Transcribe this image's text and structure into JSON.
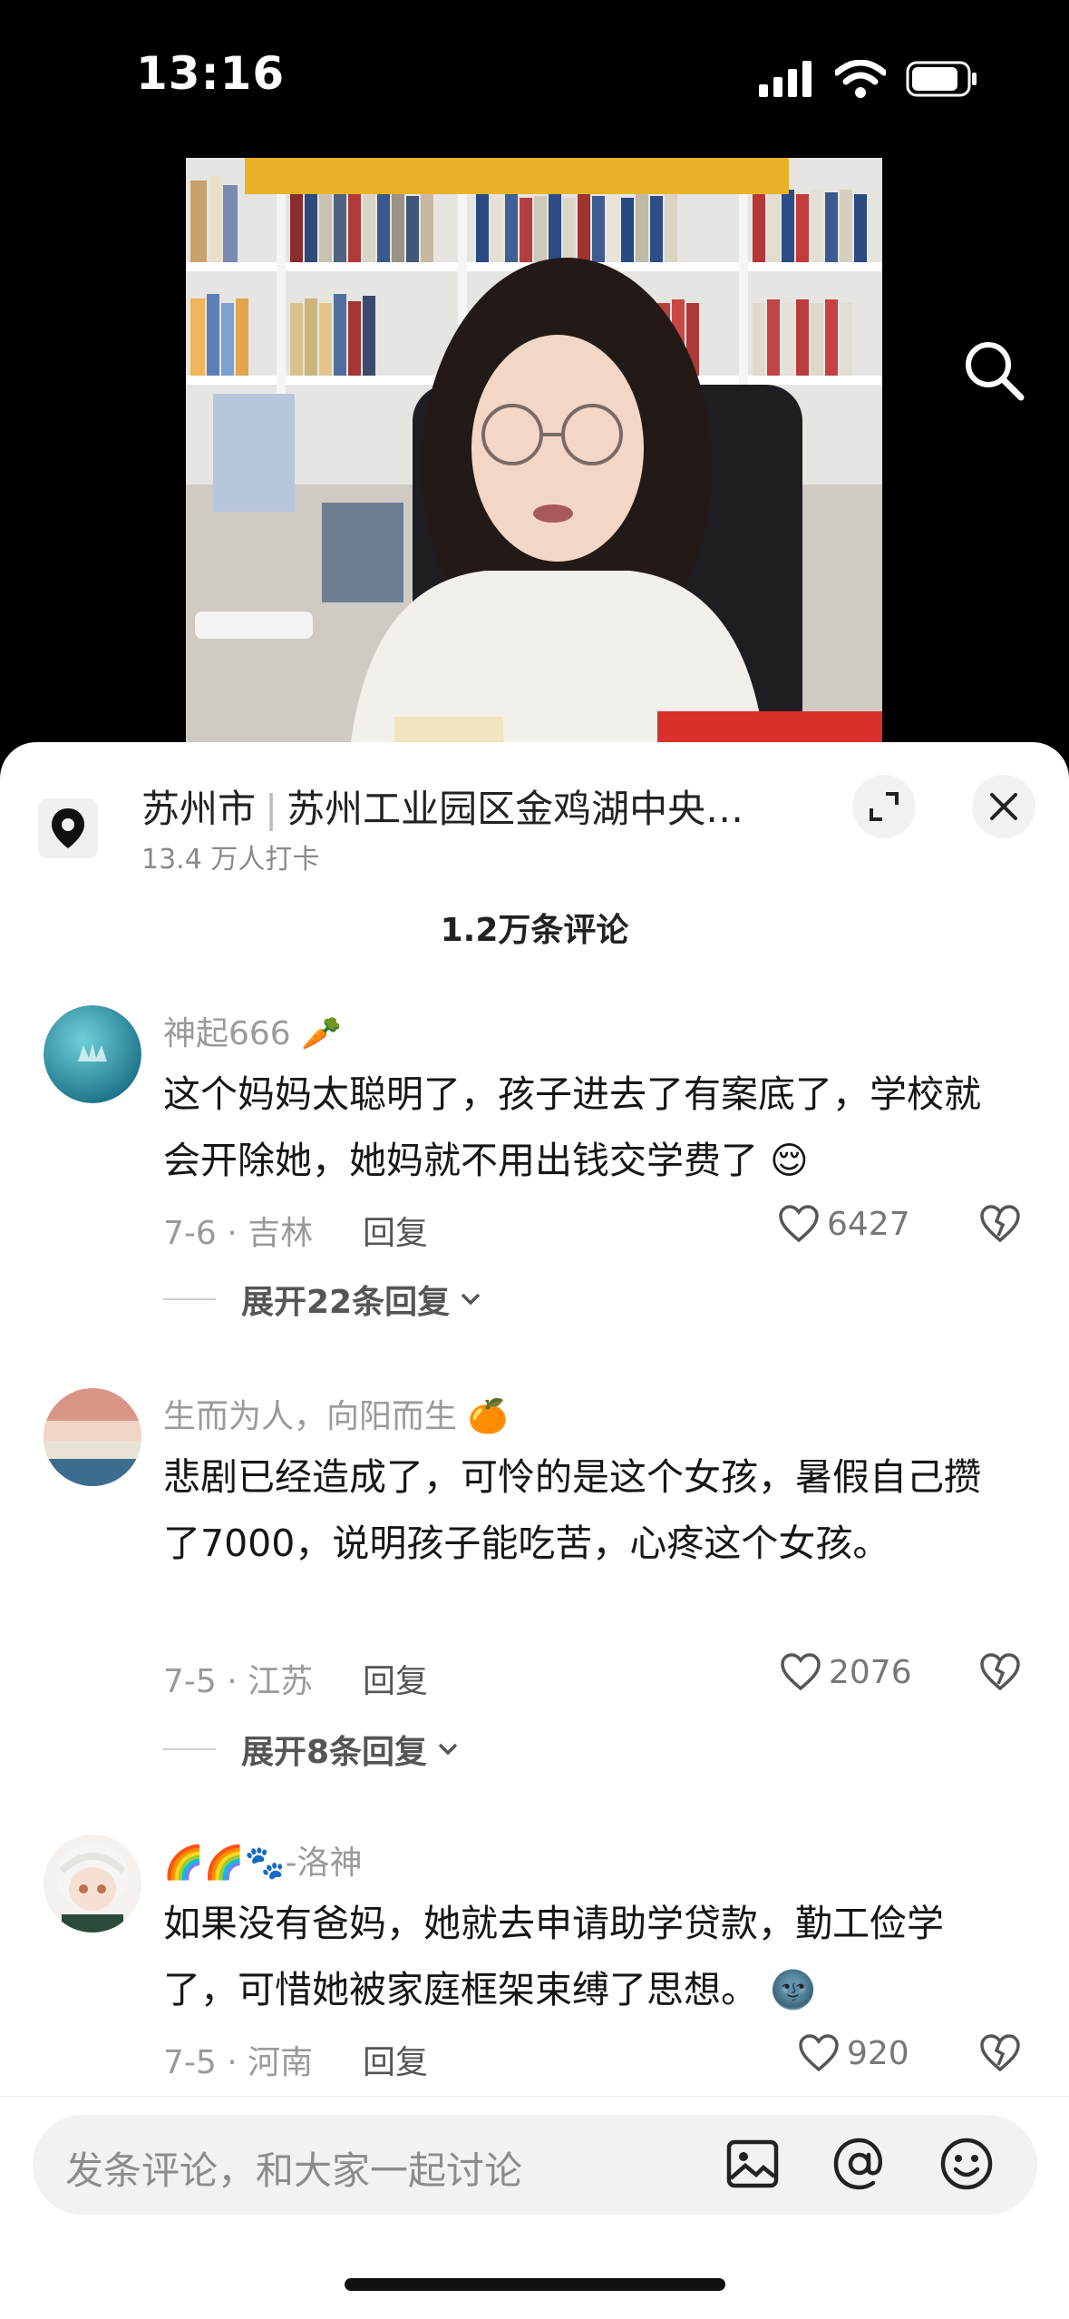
{
  "status_bar": {
    "time": "13:16"
  },
  "location": {
    "city": "苏州市",
    "place": "苏州工业园区金鸡湖中央…",
    "checkins": "13.4 万人打卡"
  },
  "comments_header": {
    "count_label": "1.2万条评论"
  },
  "comments": [
    {
      "username": "神起666",
      "text": "这个妈妈太聪明了，孩子进去了有案底了，学校就会开除她，她妈就不用出钱交学费了",
      "date_loc": "7-6 · 吉林",
      "reply_label": "回复",
      "likes": "6427",
      "expand_label": "展开22条回复"
    },
    {
      "username": "生而为人，向阳而生",
      "text": "悲剧已经造成了，可怜的是这个女孩，暑假自己攒了7000，说明孩子能吃苦，心疼这个女孩。",
      "date_loc": "7-5 · 江苏",
      "reply_label": "回复",
      "likes": "2076",
      "expand_label": "展开8条回复"
    },
    {
      "username": "🌈🌈🐾-洛神",
      "text": "如果没有爸妈，她就去申请助学贷款，勤工俭学了，可惜她被家庭框架束缚了思想。",
      "date_loc": "7-5 · 河南",
      "reply_label": "回复",
      "likes": "920"
    }
  ],
  "input_bar": {
    "placeholder": "发条评论，和大家一起讨论"
  }
}
